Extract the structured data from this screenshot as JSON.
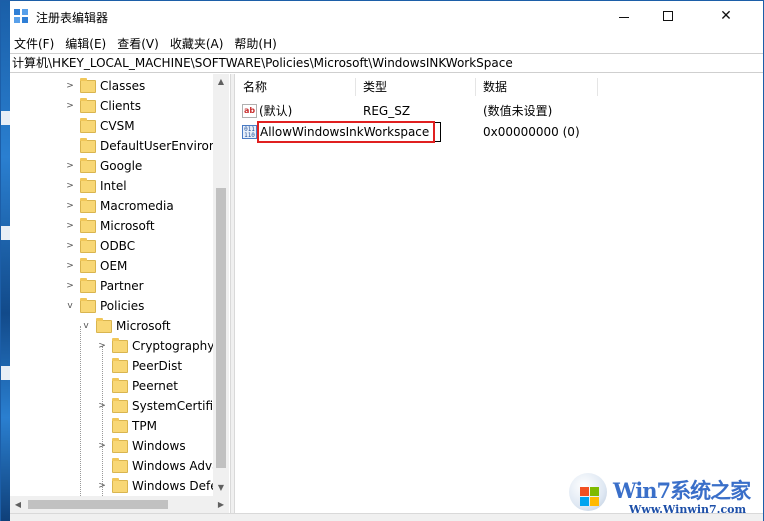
{
  "window": {
    "title": "注册表编辑器"
  },
  "menu": [
    "文件(F)",
    "编辑(E)",
    "查看(V)",
    "收藏夹(A)",
    "帮助(H)"
  ],
  "address": "计算机\\HKEY_LOCAL_MACHINE\\SOFTWARE\\Policies\\Microsoft\\WindowsINKWorkSpace",
  "tree": {
    "items": [
      {
        "label": "Classes",
        "expanded": false
      },
      {
        "label": "Clients",
        "expanded": false
      },
      {
        "label": "CVSM",
        "expanded": false
      },
      {
        "label": "DefaultUserEnvironr",
        "expanded": false
      },
      {
        "label": "Google",
        "expanded": false
      },
      {
        "label": "Intel",
        "expanded": false
      },
      {
        "label": "Macromedia",
        "expanded": false
      },
      {
        "label": "Microsoft",
        "expanded": false
      },
      {
        "label": "ODBC",
        "expanded": false
      },
      {
        "label": "OEM",
        "expanded": false
      },
      {
        "label": "Partner",
        "expanded": false
      },
      {
        "label": "Policies",
        "expanded": true
      },
      {
        "label": "Microsoft",
        "expanded": true
      },
      {
        "label": "Cryptography",
        "expanded": false
      },
      {
        "label": "PeerDist",
        "expanded": false
      },
      {
        "label": "Peernet",
        "expanded": false
      },
      {
        "label": "SystemCertifica",
        "expanded": false
      },
      {
        "label": "TPM",
        "expanded": false
      },
      {
        "label": "Windows",
        "expanded": false
      },
      {
        "label": "Windows Adva",
        "expanded": false
      },
      {
        "label": "Windows Defe",
        "expanded": false
      }
    ]
  },
  "columns": {
    "name": "名称",
    "type": "类型",
    "data": "数据"
  },
  "values": [
    {
      "name": "(默认)",
      "type": "REG_SZ",
      "data": "(数值未设置)",
      "icon": "string-value-icon"
    },
    {
      "name": "AllowWindowsInkWorkspace",
      "type": "",
      "data": "0x00000000 (0)",
      "icon": "dword-value-icon",
      "editing": true
    }
  ],
  "watermark": {
    "title": "Win7系统之家",
    "url": "Www.Winwin7.com"
  },
  "colors": {
    "highlight": "#e02020",
    "accent": "#1c5ea8",
    "folder": "#f8d775"
  }
}
